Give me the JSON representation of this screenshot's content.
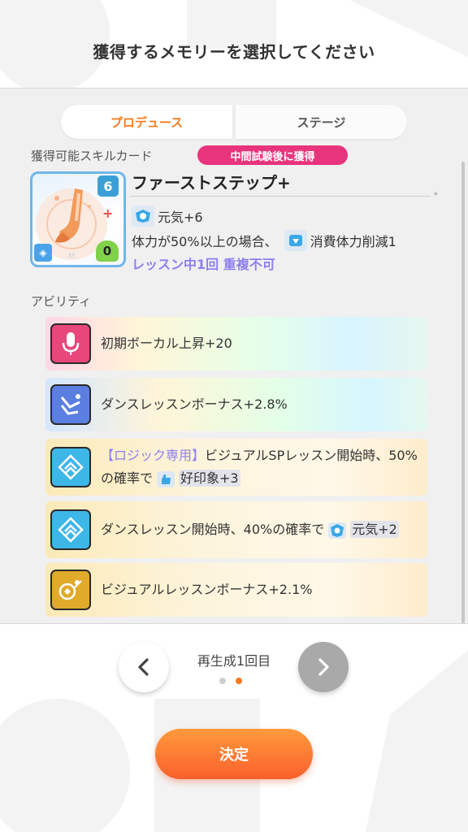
{
  "header": {
    "title": "獲得するメモリーを選択してください"
  },
  "tabs": [
    {
      "label": "プロデュース",
      "active": true
    },
    {
      "label": "ステージ",
      "active": false
    }
  ],
  "skill_section": {
    "label": "獲得可能スキルカード",
    "badge": "中間試験後に獲得",
    "card": {
      "cost_top": "6",
      "cost_bottom": "0",
      "name": "ファーストステップ+",
      "effect1": "元気+6",
      "effect2_prefix": "体力が50%以上の場合、",
      "effect2_value": "消費体力削減1",
      "limit": "レッスン中1回 重複不可"
    }
  },
  "ability_section": {
    "label": "アビリティ",
    "items": [
      {
        "text": "初期ボーカル上昇+20",
        "icon": "microphone-icon"
      },
      {
        "text": "ダンスレッスンボーナス+2.8%",
        "icon": "dance-icon"
      },
      {
        "tag": "【ロジック専用】",
        "text_a": "ビジュアルSPレッスン開始時、50%の確率で",
        "text_b": "好印象+3",
        "icon": "chevron-up-icon"
      },
      {
        "text_a": "ダンスレッスン開始時、40%の確率で",
        "text_b": "元気+2",
        "icon": "chevron-up-icon"
      },
      {
        "text": "ビジュアルレッスンボーナス+2.1%",
        "icon": "visual-icon"
      }
    ]
  },
  "pager": {
    "label": "再生成1回目",
    "current": 2,
    "total": 2
  },
  "confirm_label": "決定",
  "colors": {
    "accent_orange": "#f47a1f",
    "badge_pink": "#e8337d",
    "limit_purple": "#8d7ff0"
  }
}
